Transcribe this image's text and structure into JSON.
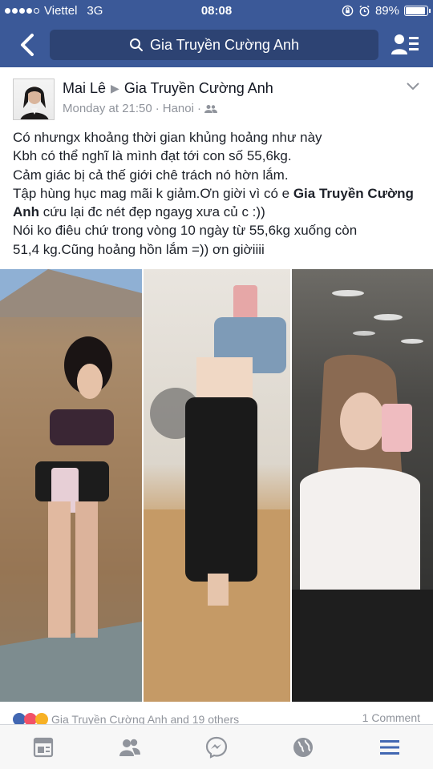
{
  "status_bar": {
    "carrier": "Viettel",
    "network": "3G",
    "time": "08:08",
    "battery": "89%"
  },
  "nav": {
    "search_text": "Gia Truyền Cường Anh"
  },
  "post": {
    "author": "Mai Lê",
    "target_page": "Gia Truyền Cường Anh",
    "timestamp": "Monday at 21:50",
    "location": "Hanoi",
    "text_lines": [
      "Có nhưngx khoảng thời gian khủng hoảng như này",
      "Kbh có thể nghĩ là mình đạt tới con số 55,6kg.",
      "Cảm giác bị cả thế giới chê trách nó hờn lắm.",
      "Tập hùng hục mag mãi k giảm.Ơn giời vì có e ",
      "Gia Truyền Cường Anh",
      " cứu lại đc nét đẹp ngayg xưa củ c :))",
      "Nói ko điêu chứ trong vòng 10 ngày từ 55,6kg xuống còn",
      "51,4 kg.Cũng hoảng hồn lắm =)) ơn giờiiii"
    ],
    "reactions_text": "Gia Truyền Cường Anh and 19 others",
    "comments_text": "1 Comment"
  },
  "colors": {
    "brand": "#3b5998",
    "tab_active": "#4267b2",
    "tab_inactive": "#90949c"
  },
  "tabs": [
    "news-feed-icon",
    "friend-requests-icon",
    "messenger-icon",
    "notifications-globe-icon",
    "more-menu-icon"
  ]
}
